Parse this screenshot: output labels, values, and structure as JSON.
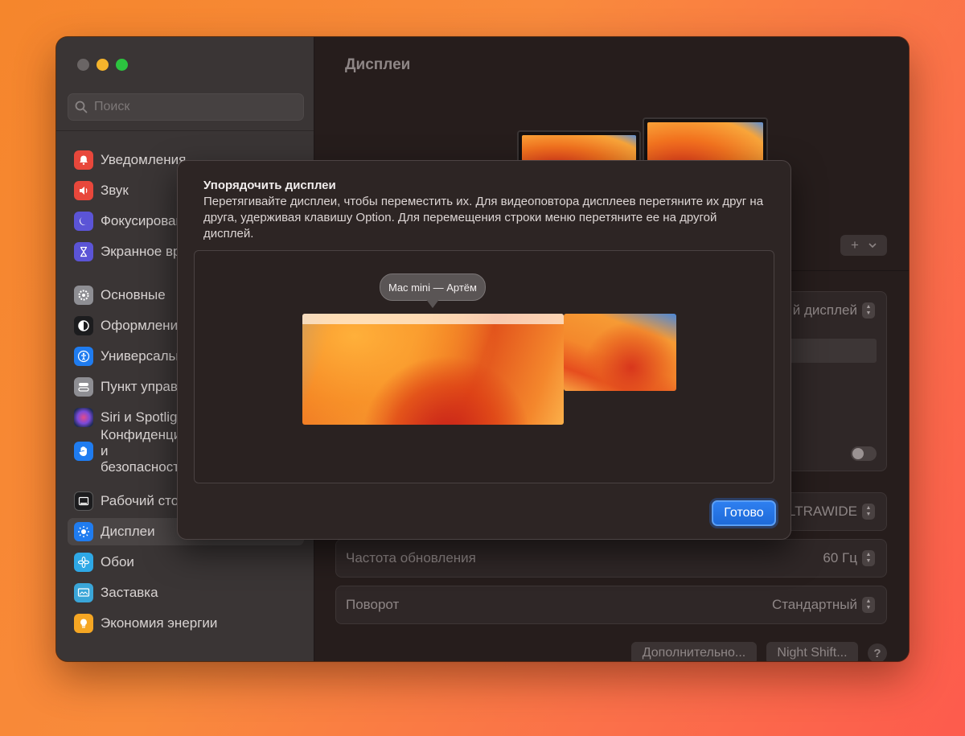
{
  "window": {
    "search_placeholder": "Поиск"
  },
  "sidebar": {
    "items": [
      {
        "label": "Уведомления",
        "icon": "bell-icon",
        "color": "#e8473b"
      },
      {
        "label": "Звук",
        "icon": "speaker-icon",
        "color": "#e8473b"
      },
      {
        "label": "Фокусирование",
        "icon": "moon-icon",
        "color": "#5b54d6"
      },
      {
        "label": "Экранное время",
        "icon": "hourglass-icon",
        "color": "#5b54d6"
      },
      {
        "label": "Основные",
        "icon": "gear-icon",
        "color": "#8e8e93"
      },
      {
        "label": "Оформление",
        "icon": "appearance-icon",
        "color": "#1c1c1e"
      },
      {
        "label": "Универсальный доступ",
        "icon": "accessibility-icon",
        "color": "#1f7cf0"
      },
      {
        "label": "Пункт управления",
        "icon": "control-center-icon",
        "color": "#8e8e93"
      },
      {
        "label": "Siri и Spotlight",
        "icon": "siri-icon",
        "color": "#3a3a6a"
      },
      {
        "label": "Конфиденциальность и безопасность",
        "icon": "hand-icon",
        "color": "#1f7cf0"
      },
      {
        "label": "Рабочий стол и Dock",
        "icon": "dock-icon",
        "color": "#1c1c1e"
      },
      {
        "label": "Дисплеи",
        "icon": "brightness-icon",
        "color": "#1f7cf0"
      },
      {
        "label": "Обои",
        "icon": "flower-icon",
        "color": "#2ea8e6"
      },
      {
        "label": "Заставка",
        "icon": "screensaver-icon",
        "color": "#3aa6d8"
      },
      {
        "label": "Экономия энергии",
        "icon": "lightbulb-icon",
        "color": "#f5a623"
      }
    ]
  },
  "main": {
    "title": "Дисплеи",
    "add_button": "+",
    "display_select_value": "й дисплей",
    "resolution_value": "LTRAWIDE",
    "refresh_label": "Частота обновления",
    "refresh_value": "60 Гц",
    "rotation_label": "Поворот",
    "rotation_value": "Стандартный",
    "advanced_button": "Дополнительно...",
    "nightshift_button": "Night Shift...",
    "help_button": "?"
  },
  "sheet": {
    "title": "Упорядочить дисплеи",
    "description": "Перетягивайте дисплеи, чтобы переместить их. Для видеоповтора дисплеев перетяните их друг на друга, удерживая клавишу Option. Для перемещения строки меню перетяните ее на другой дисплей.",
    "tooltip": "Mac mini — Артём",
    "done_button": "Готово"
  }
}
